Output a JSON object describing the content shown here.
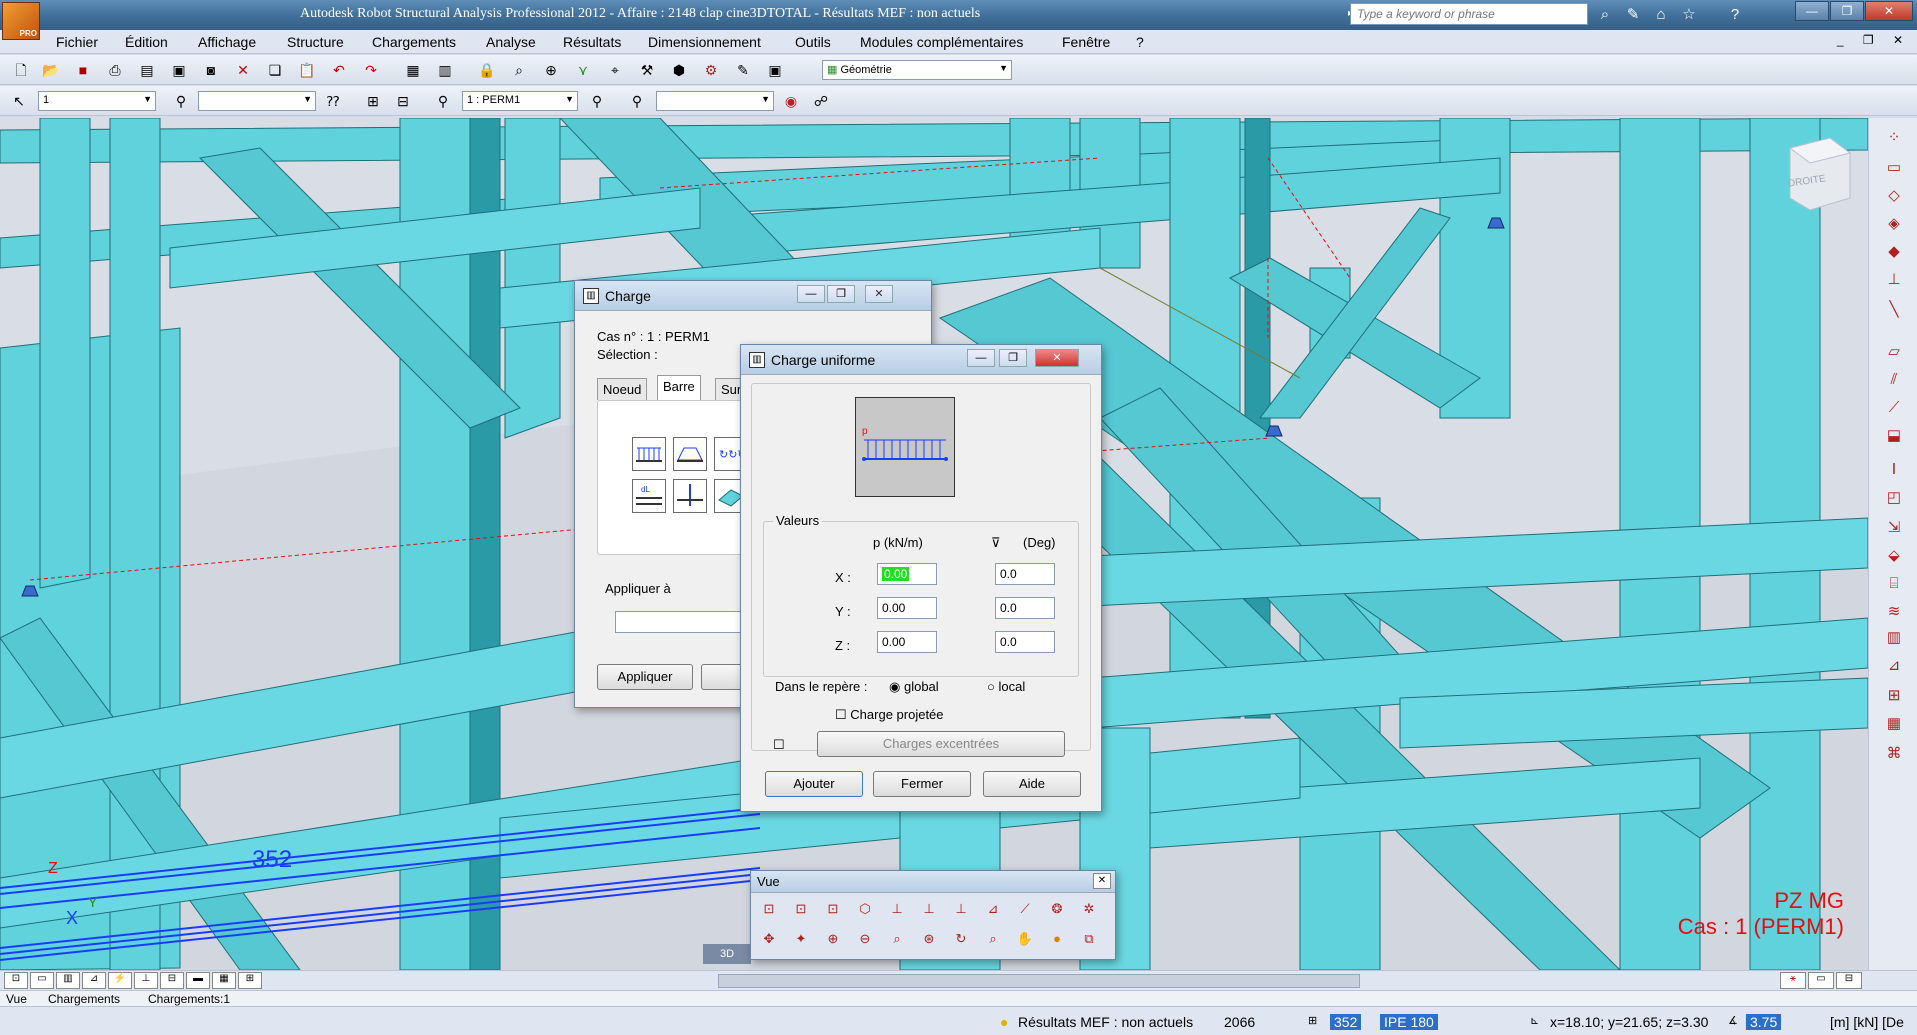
{
  "app": {
    "title": "Autodesk Robot Structural Analysis Professional 2012 - Affaire : 2148 clap cine3DTOTAL - Résultats MEF : non actuels",
    "logo_text": "PRO",
    "search_placeholder": "Type a keyword or phrase"
  },
  "menu": [
    "Fichier",
    "Édition",
    "Affichage",
    "Structure",
    "Chargements",
    "Analyse",
    "Résultats",
    "Dimensionnement",
    "Outils",
    "Modules complémentaires",
    "Fenêtre",
    "?"
  ],
  "toolbar": {
    "layout_value": "Géométrie",
    "combo1_value": "1",
    "combo2_value": "",
    "case_value": "1 : PERM1",
    "combo4_value": ""
  },
  "viewport": {
    "bar_label": "352",
    "axis_z": "Z",
    "axis_y": "Y",
    "axis_x": "X",
    "view_cube_label": "DROITE",
    "corner_line1": "PZ MG",
    "corner_line2": "Cas : 1 (PERM1)",
    "mode_tab": "3D"
  },
  "charge_dialog": {
    "title": "Charge",
    "case_label": "Cas n° : 1 : PERM1",
    "selection_label": "Sélection :",
    "tabs": [
      "Noeud",
      "Barre",
      "Surfa"
    ],
    "apply_to_label": "Appliquer à",
    "apply_button": "Appliquer",
    "close_button": "Fe"
  },
  "uniform_dialog": {
    "title": "Charge uniforme",
    "diagram_label": "p",
    "group_label": "Valeurs",
    "p_header": "p  (kN/m)",
    "angle_header": "(Deg)",
    "rows": [
      {
        "axis": "X :",
        "p": "0.00",
        "angle": "0.0"
      },
      {
        "axis": "Y :",
        "p": "0.00",
        "angle": "0.0"
      },
      {
        "axis": "Z :",
        "p": "0.00",
        "angle": "0.0"
      }
    ],
    "repere_label": "Dans le repère :",
    "global_label": "global",
    "local_label": "local",
    "projected_label": "Charge projetée",
    "eccentric_button": "Charges excentrées",
    "add_button": "Ajouter",
    "close_button": "Fermer",
    "help_button": "Aide"
  },
  "vue_panel": {
    "title": "Vue",
    "close": "✕"
  },
  "bottom_tabs": [
    "Vue",
    "Chargements",
    "Chargements:1"
  ],
  "status": {
    "fem_status": "Résultats MEF : non actuels",
    "node_count": "2066",
    "bar_number": "352",
    "section": "IPE 180",
    "coords": "x=18.10; y=21.65; z=3.30",
    "angle": "3.75",
    "units": "[m] [kN] [De"
  },
  "colors": {
    "steel": "#5fd2dc",
    "steel_dark": "#2a8f9a",
    "selected_bar": "#1a3cff",
    "active_field": "#22dd22",
    "annotation_red": "#e01010"
  }
}
